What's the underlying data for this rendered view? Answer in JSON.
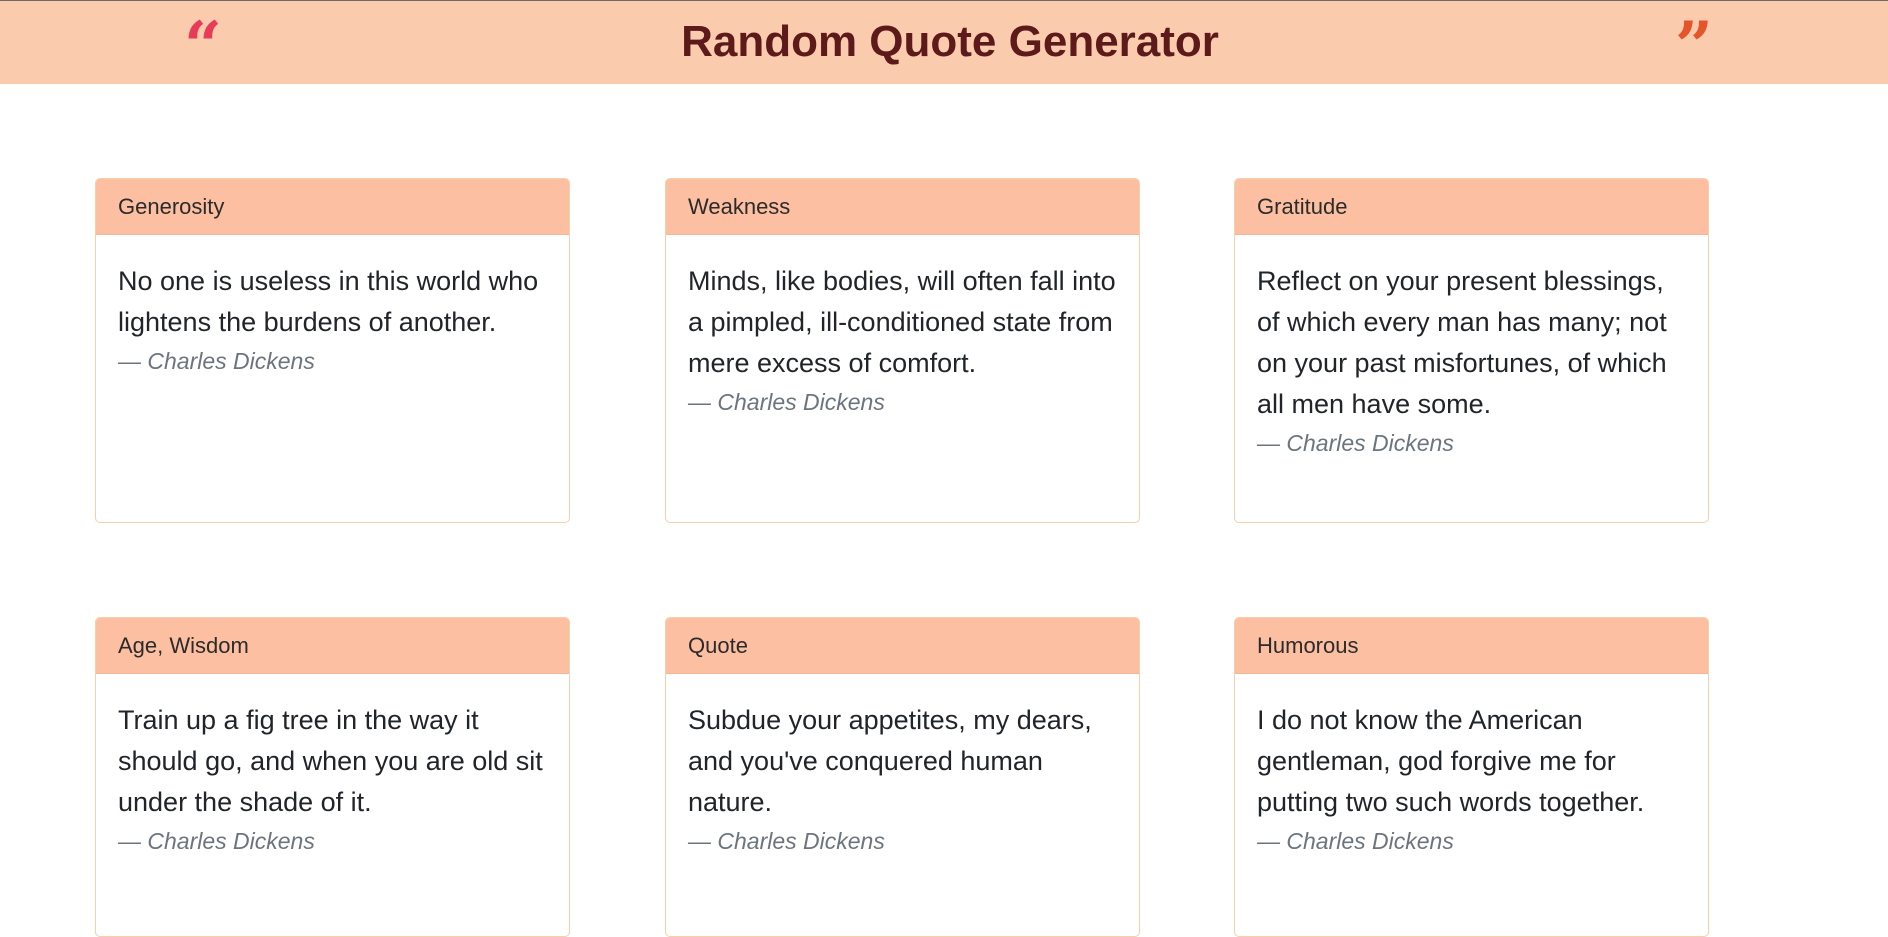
{
  "header": {
    "title": "Random Quote Generator",
    "left_mark": "“",
    "right_mark": "”"
  },
  "cards": [
    {
      "category": "Generosity",
      "quote": "No one is useless in this world who lightens the burdens of another.",
      "author": "— Charles Dickens"
    },
    {
      "category": "Weakness",
      "quote": "Minds, like bodies, will often fall into a pimpled, ill-conditioned state from mere excess of comfort.",
      "author": "— Charles Dickens"
    },
    {
      "category": "Gratitude",
      "quote": "Reflect on your present blessings, of which every man has many; not on your past misfortunes, of which all men have some.",
      "author": "— Charles Dickens"
    },
    {
      "category": "Age, Wisdom",
      "quote": "Train up a fig tree in the way it should go, and when you are old sit under the shade of it.",
      "author": "— Charles Dickens"
    },
    {
      "category": "Quote",
      "quote": "Subdue your appetites, my dears, and you've conquered human nature.",
      "author": "— Charles Dickens"
    },
    {
      "category": "Humorous",
      "quote": "I do not know the American gentleman, god forgive me for putting two such words together.",
      "author": "— Charles Dickens"
    }
  ]
}
